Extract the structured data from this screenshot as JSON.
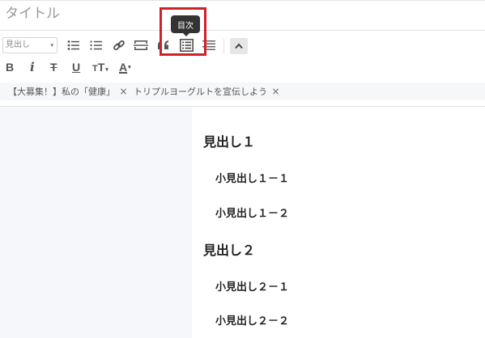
{
  "title": {
    "placeholder": "タイトル"
  },
  "toolbar": {
    "heading_select": "見出し",
    "tooltip": "目次",
    "format": {
      "bold": "B",
      "italic": "i",
      "strike": "T",
      "underline": "U",
      "textsize": "T",
      "color": "A"
    }
  },
  "tags": [
    {
      "label": "【大募集！】私の「健康」",
      "remove": "×"
    },
    {
      "label": "トリプルヨーグルトを宣伝しよう",
      "remove": "×"
    }
  ],
  "content": {
    "headings": [
      {
        "level": 1,
        "text": "見出し１"
      },
      {
        "level": 2,
        "text": "小見出し１－１"
      },
      {
        "level": 2,
        "text": "小見出し１－２"
      },
      {
        "level": 1,
        "text": "見出し２"
      },
      {
        "level": 2,
        "text": "小見出し２－１"
      },
      {
        "level": 2,
        "text": "小見出し２－２"
      }
    ]
  },
  "colors": {
    "highlight": "#d0202a",
    "tooltip_bg": "#333333",
    "pane_bg": "#f5f7fa"
  }
}
